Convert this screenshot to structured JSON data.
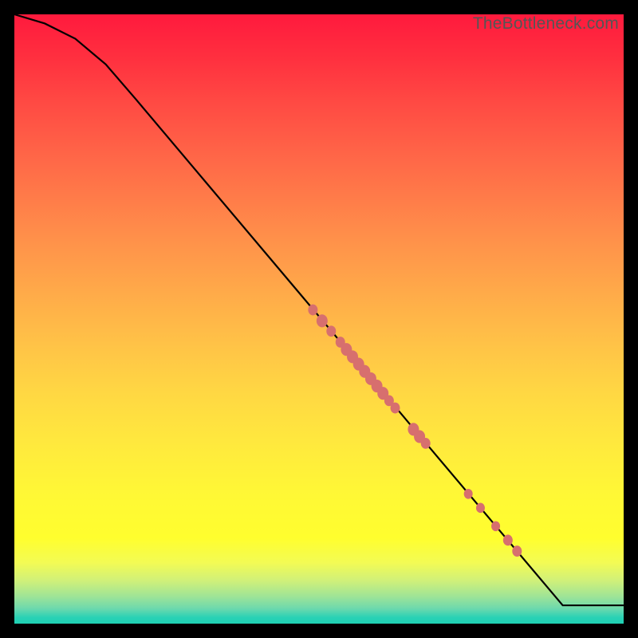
{
  "watermark": "TheBottleneck.com",
  "chart_data": {
    "type": "line",
    "title": "",
    "xlabel": "",
    "ylabel": "",
    "xlim": [
      0,
      100
    ],
    "ylim": [
      0,
      100
    ],
    "curve": [
      {
        "x": 0,
        "y": 100
      },
      {
        "x": 5,
        "y": 98.5
      },
      {
        "x": 10,
        "y": 96
      },
      {
        "x": 15,
        "y": 91.8
      },
      {
        "x": 20,
        "y": 86
      },
      {
        "x": 90,
        "y": 3
      },
      {
        "x": 100,
        "y": 3
      }
    ],
    "points": [
      {
        "x": 49,
        "y": 51.5,
        "r": 6
      },
      {
        "x": 50.5,
        "y": 49.7,
        "r": 7
      },
      {
        "x": 52,
        "y": 48,
        "r": 6
      },
      {
        "x": 53.5,
        "y": 46.2,
        "r": 6
      },
      {
        "x": 54.5,
        "y": 45,
        "r": 7
      },
      {
        "x": 55.5,
        "y": 43.8,
        "r": 7
      },
      {
        "x": 56.5,
        "y": 42.6,
        "r": 7
      },
      {
        "x": 57.5,
        "y": 41.4,
        "r": 7
      },
      {
        "x": 58.5,
        "y": 40.2,
        "r": 7
      },
      {
        "x": 59.5,
        "y": 39,
        "r": 7
      },
      {
        "x": 60.5,
        "y": 37.8,
        "r": 7
      },
      {
        "x": 61.5,
        "y": 36.6,
        "r": 6
      },
      {
        "x": 62.5,
        "y": 35.4,
        "r": 6
      },
      {
        "x": 65.5,
        "y": 31.9,
        "r": 7
      },
      {
        "x": 66.5,
        "y": 30.7,
        "r": 7
      },
      {
        "x": 67.5,
        "y": 29.6,
        "r": 6
      },
      {
        "x": 74.5,
        "y": 21.3,
        "r": 5.5
      },
      {
        "x": 76.5,
        "y": 19,
        "r": 5.5
      },
      {
        "x": 79,
        "y": 16,
        "r": 5.5
      },
      {
        "x": 81,
        "y": 13.7,
        "r": 6
      },
      {
        "x": 82.5,
        "y": 11.9,
        "r": 6
      }
    ]
  }
}
